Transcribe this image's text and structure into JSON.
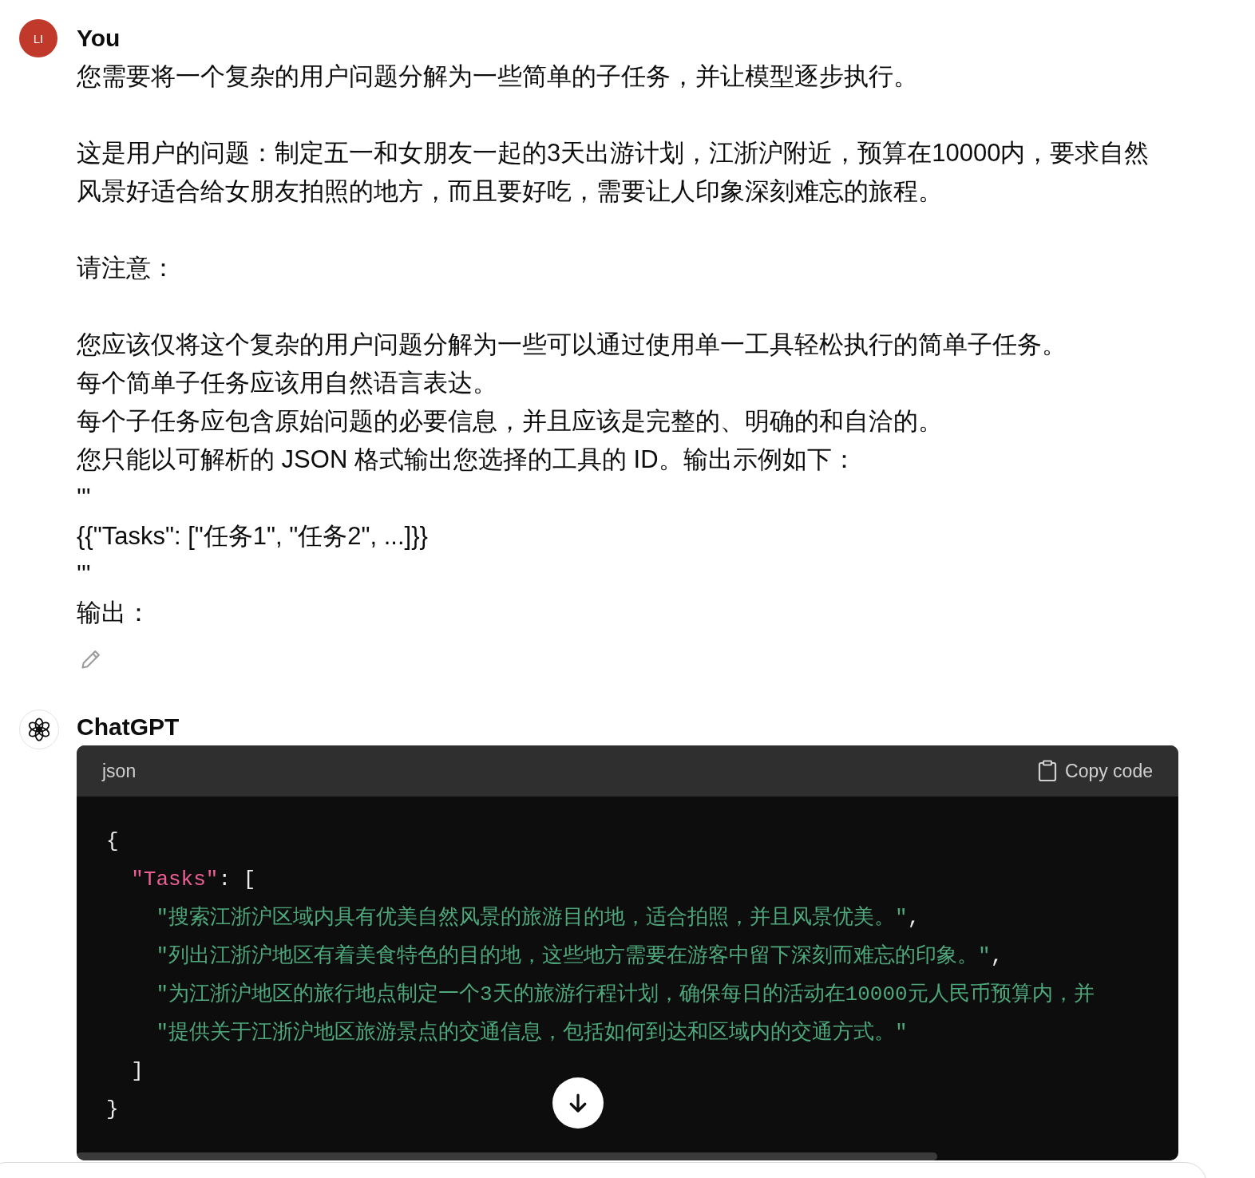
{
  "messages": [
    {
      "kind": "user",
      "author": "You",
      "avatar": "LI",
      "paragraphs": [
        [
          "您需要将一个复杂的用户问题分解为一些简单的子任务，并让模型逐步执行。"
        ],
        [
          "这是用户的问题：制定五一和女朋友一起的3天出游计划，江浙沪附近，预算在10000内，要求自然风景好适合给女朋友拍照的地方，而且要好吃，需要让人印象深刻难忘的旅程。"
        ],
        [
          "请注意："
        ],
        [
          "您应该仅将这个复杂的用户问题分解为一些可以通过使用单一工具轻松执行的简单子任务。",
          "每个简单子任务应该用自然语言表达。",
          "每个子任务应包含原始问题的必要信息，并且应该是完整的、明确的和自洽的。",
          "您只能以可解析的 JSON 格式输出您选择的工具的 ID。输出示例如下：",
          "'''",
          "{{\"Tasks\": [\"任务1\", \"任务2\", ...]}}",
          "'''",
          "输出："
        ]
      ]
    },
    {
      "kind": "assistant",
      "author": "ChatGPT",
      "code_block": {
        "language": "json",
        "copy_label": "Copy code",
        "lines": [
          {
            "tokens": [
              {
                "kind": "punct",
                "text": "{"
              }
            ]
          },
          {
            "tokens": [
              {
                "kind": "key",
                "text": "  \"Tasks\""
              },
              {
                "kind": "punct",
                "text": ": ["
              }
            ]
          },
          {
            "tokens": [
              {
                "kind": "string",
                "text": "    \"搜索江浙沪区域内具有优美自然风景的旅游目的地，适合拍照，并且风景优美。\""
              },
              {
                "kind": "punct",
                "text": ","
              }
            ]
          },
          {
            "tokens": [
              {
                "kind": "string",
                "text": "    \"列出江浙沪地区有着美食特色的目的地，这些地方需要在游客中留下深刻而难忘的印象。\""
              },
              {
                "kind": "punct",
                "text": ","
              }
            ]
          },
          {
            "tokens": [
              {
                "kind": "string",
                "text": "    \"为江浙沪地区的旅行地点制定一个3天的旅游行程计划，确保每日的活动在10000元人民币预算内，并"
              }
            ]
          },
          {
            "tokens": [
              {
                "kind": "string",
                "text": "    \"提供关于江浙沪地区旅游景点的交通信息，包括如何到达和区域内的交通方式。\""
              }
            ]
          },
          {
            "tokens": [
              {
                "kind": "punct",
                "text": "  ]"
              }
            ]
          },
          {
            "tokens": [
              {
                "kind": "punct",
                "text": "}"
              }
            ]
          }
        ]
      }
    }
  ]
}
